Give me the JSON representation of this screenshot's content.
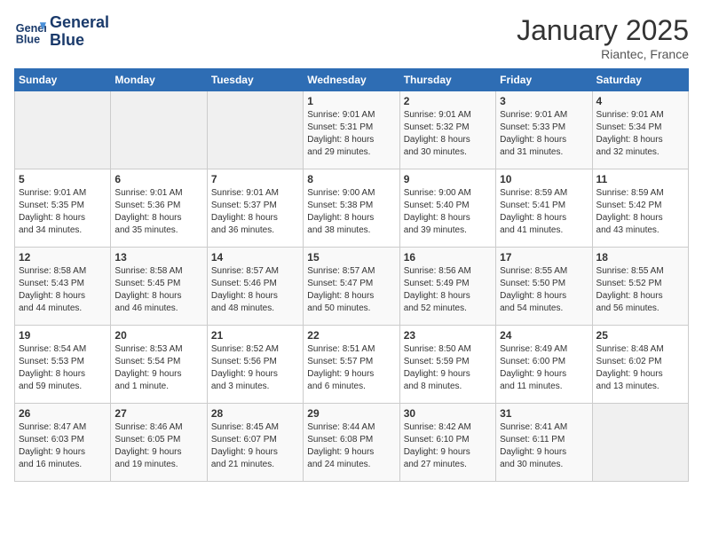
{
  "header": {
    "logo_line1": "General",
    "logo_line2": "Blue",
    "month_title": "January 2025",
    "location": "Riantec, France"
  },
  "weekdays": [
    "Sunday",
    "Monday",
    "Tuesday",
    "Wednesday",
    "Thursday",
    "Friday",
    "Saturday"
  ],
  "weeks": [
    [
      {
        "day": "",
        "info": ""
      },
      {
        "day": "",
        "info": ""
      },
      {
        "day": "",
        "info": ""
      },
      {
        "day": "1",
        "info": "Sunrise: 9:01 AM\nSunset: 5:31 PM\nDaylight: 8 hours\nand 29 minutes."
      },
      {
        "day": "2",
        "info": "Sunrise: 9:01 AM\nSunset: 5:32 PM\nDaylight: 8 hours\nand 30 minutes."
      },
      {
        "day": "3",
        "info": "Sunrise: 9:01 AM\nSunset: 5:33 PM\nDaylight: 8 hours\nand 31 minutes."
      },
      {
        "day": "4",
        "info": "Sunrise: 9:01 AM\nSunset: 5:34 PM\nDaylight: 8 hours\nand 32 minutes."
      }
    ],
    [
      {
        "day": "5",
        "info": "Sunrise: 9:01 AM\nSunset: 5:35 PM\nDaylight: 8 hours\nand 34 minutes."
      },
      {
        "day": "6",
        "info": "Sunrise: 9:01 AM\nSunset: 5:36 PM\nDaylight: 8 hours\nand 35 minutes."
      },
      {
        "day": "7",
        "info": "Sunrise: 9:01 AM\nSunset: 5:37 PM\nDaylight: 8 hours\nand 36 minutes."
      },
      {
        "day": "8",
        "info": "Sunrise: 9:00 AM\nSunset: 5:38 PM\nDaylight: 8 hours\nand 38 minutes."
      },
      {
        "day": "9",
        "info": "Sunrise: 9:00 AM\nSunset: 5:40 PM\nDaylight: 8 hours\nand 39 minutes."
      },
      {
        "day": "10",
        "info": "Sunrise: 8:59 AM\nSunset: 5:41 PM\nDaylight: 8 hours\nand 41 minutes."
      },
      {
        "day": "11",
        "info": "Sunrise: 8:59 AM\nSunset: 5:42 PM\nDaylight: 8 hours\nand 43 minutes."
      }
    ],
    [
      {
        "day": "12",
        "info": "Sunrise: 8:58 AM\nSunset: 5:43 PM\nDaylight: 8 hours\nand 44 minutes."
      },
      {
        "day": "13",
        "info": "Sunrise: 8:58 AM\nSunset: 5:45 PM\nDaylight: 8 hours\nand 46 minutes."
      },
      {
        "day": "14",
        "info": "Sunrise: 8:57 AM\nSunset: 5:46 PM\nDaylight: 8 hours\nand 48 minutes."
      },
      {
        "day": "15",
        "info": "Sunrise: 8:57 AM\nSunset: 5:47 PM\nDaylight: 8 hours\nand 50 minutes."
      },
      {
        "day": "16",
        "info": "Sunrise: 8:56 AM\nSunset: 5:49 PM\nDaylight: 8 hours\nand 52 minutes."
      },
      {
        "day": "17",
        "info": "Sunrise: 8:55 AM\nSunset: 5:50 PM\nDaylight: 8 hours\nand 54 minutes."
      },
      {
        "day": "18",
        "info": "Sunrise: 8:55 AM\nSunset: 5:52 PM\nDaylight: 8 hours\nand 56 minutes."
      }
    ],
    [
      {
        "day": "19",
        "info": "Sunrise: 8:54 AM\nSunset: 5:53 PM\nDaylight: 8 hours\nand 59 minutes."
      },
      {
        "day": "20",
        "info": "Sunrise: 8:53 AM\nSunset: 5:54 PM\nDaylight: 9 hours\nand 1 minute."
      },
      {
        "day": "21",
        "info": "Sunrise: 8:52 AM\nSunset: 5:56 PM\nDaylight: 9 hours\nand 3 minutes."
      },
      {
        "day": "22",
        "info": "Sunrise: 8:51 AM\nSunset: 5:57 PM\nDaylight: 9 hours\nand 6 minutes."
      },
      {
        "day": "23",
        "info": "Sunrise: 8:50 AM\nSunset: 5:59 PM\nDaylight: 9 hours\nand 8 minutes."
      },
      {
        "day": "24",
        "info": "Sunrise: 8:49 AM\nSunset: 6:00 PM\nDaylight: 9 hours\nand 11 minutes."
      },
      {
        "day": "25",
        "info": "Sunrise: 8:48 AM\nSunset: 6:02 PM\nDaylight: 9 hours\nand 13 minutes."
      }
    ],
    [
      {
        "day": "26",
        "info": "Sunrise: 8:47 AM\nSunset: 6:03 PM\nDaylight: 9 hours\nand 16 minutes."
      },
      {
        "day": "27",
        "info": "Sunrise: 8:46 AM\nSunset: 6:05 PM\nDaylight: 9 hours\nand 19 minutes."
      },
      {
        "day": "28",
        "info": "Sunrise: 8:45 AM\nSunset: 6:07 PM\nDaylight: 9 hours\nand 21 minutes."
      },
      {
        "day": "29",
        "info": "Sunrise: 8:44 AM\nSunset: 6:08 PM\nDaylight: 9 hours\nand 24 minutes."
      },
      {
        "day": "30",
        "info": "Sunrise: 8:42 AM\nSunset: 6:10 PM\nDaylight: 9 hours\nand 27 minutes."
      },
      {
        "day": "31",
        "info": "Sunrise: 8:41 AM\nSunset: 6:11 PM\nDaylight: 9 hours\nand 30 minutes."
      },
      {
        "day": "",
        "info": ""
      }
    ]
  ]
}
